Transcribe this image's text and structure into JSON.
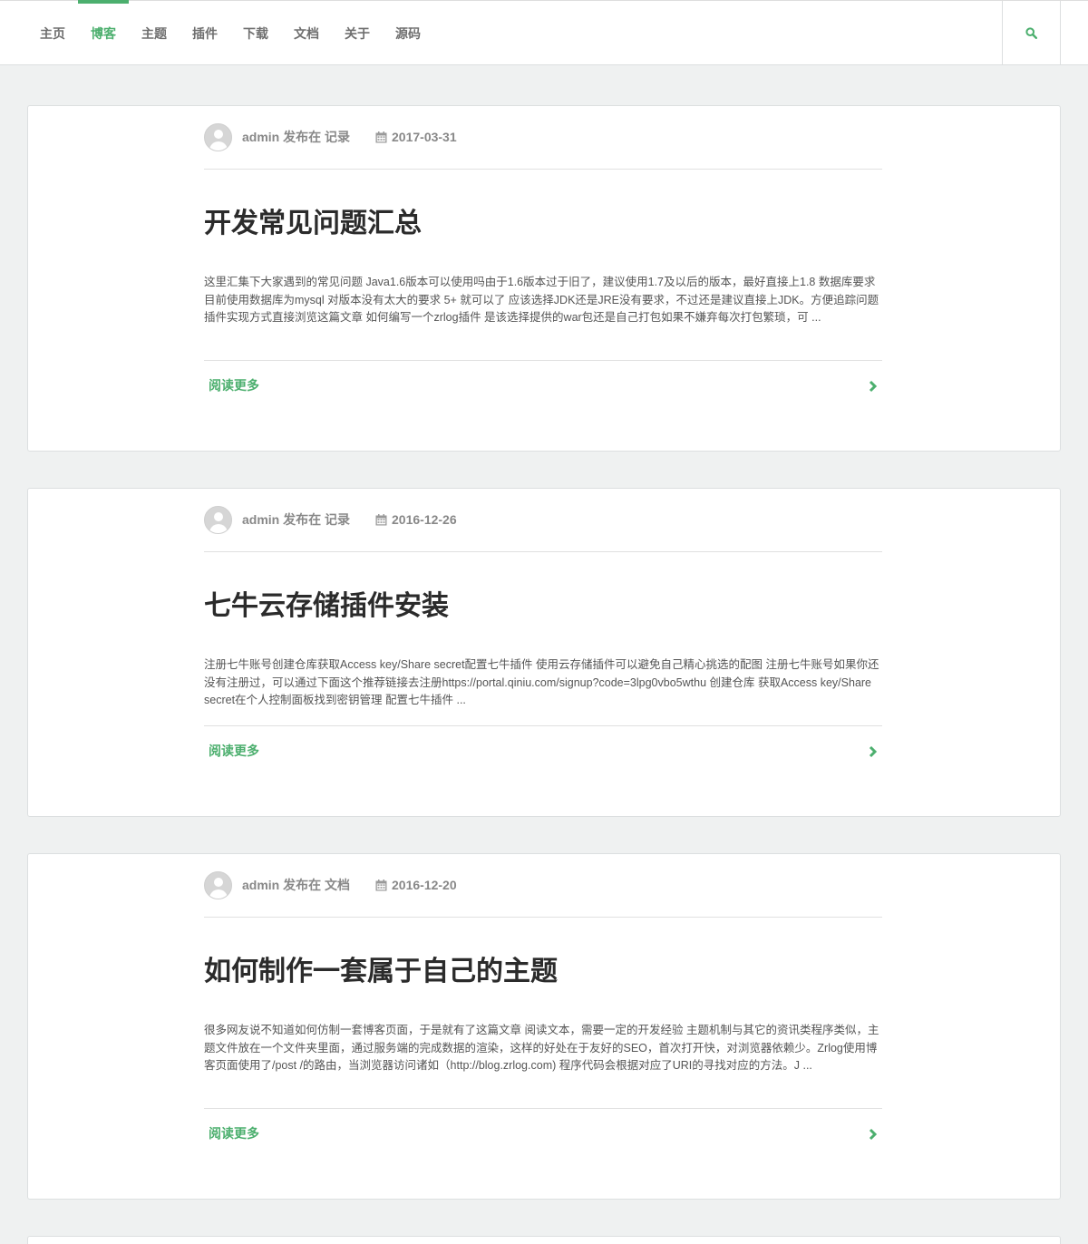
{
  "nav": {
    "items": [
      {
        "label": "主页"
      },
      {
        "label": "博客"
      },
      {
        "label": "主题"
      },
      {
        "label": "插件"
      },
      {
        "label": "下载"
      },
      {
        "label": "文档"
      },
      {
        "label": "关于"
      },
      {
        "label": "源码"
      }
    ],
    "active_index": 1,
    "search_icon": "search-icon"
  },
  "colors": {
    "accent": "#4caf6e",
    "background": "#eff1f1",
    "muted_text": "#888888"
  },
  "posts": [
    {
      "author_line": "admin 发布在 记录",
      "date": "2017-03-31",
      "title": "开发常见问题汇总",
      "excerpt": "这里汇集下大家遇到的常见问题 Java1.6版本可以使用吗由于1.6版本过于旧了，建议使用1.7及以后的版本，最好直接上1.8 数据库要求目前使用数据库为mysql 对版本没有太大的要求 5+ 就可以了 应该选择JDK还是JRE没有要求，不过还是建议直接上JDK。方便追踪问题 插件实现方式直接浏览这篇文章 如何编写一个zrlog插件 是该选择提供的war包还是自己打包如果不嫌弃每次打包繁琐，可 ...",
      "read_more": "阅读更多"
    },
    {
      "author_line": "admin 发布在 记录",
      "date": "2016-12-26",
      "title": "七牛云存储插件安装",
      "excerpt": "注册七牛账号创建仓库获取Access key/Share secret配置七牛插件 使用云存储插件可以避免自己精心挑选的配图 注册七牛账号如果你还没有注册过，可以通过下面这个推荐链接去注册https://portal.qiniu.com/signup?code=3lpg0vbo5wthu 创建仓库 获取Access key/Share secret在个人控制面板找到密钥管理 配置七牛插件 ...",
      "read_more": "阅读更多"
    },
    {
      "author_line": "admin 发布在 文档",
      "date": "2016-12-20",
      "title": "如何制作一套属于自己的主题",
      "excerpt": "很多网友说不知道如何仿制一套博客页面，于是就有了这篇文章 阅读文本，需要一定的开发经验 主题机制与其它的资讯类程序类似，主题文件放在一个文件夹里面，通过服务端的完成数据的渲染，这样的好处在于友好的SEO，首次打开快，对浏览器依赖少。Zrlog使用博客页面使用了/post /的路由，当浏览器访问诸如（http://blog.zrlog.com) 程序代码会根据对应了URI的寻找对应的方法。J ...",
      "read_more": "阅读更多"
    }
  ]
}
